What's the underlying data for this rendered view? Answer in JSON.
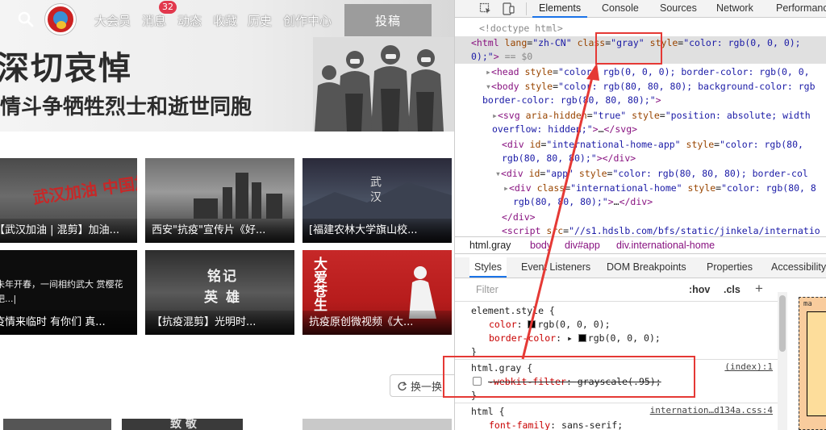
{
  "nav": {
    "items": [
      "大会员",
      "消息",
      "动态",
      "收藏",
      "历史",
      "创作中心"
    ],
    "badge": "32",
    "upload": "投稿"
  },
  "banner": {
    "title": "深切哀悼",
    "subtitle": "情斗争牺牲烈士和逝世同胞"
  },
  "videos": [
    {
      "caption": "【武汉加油 | 混剪】加油...",
      "overlay": "武汉加油 中国加油"
    },
    {
      "caption": "西安\"抗疫\"宣传片《好...",
      "overlay": ""
    },
    {
      "caption": "[福建农林大学旗山校...",
      "overlay": "武 汉"
    },
    {
      "caption": "疫情来临时 有你们 真...",
      "overlay": "未年开春，一间相约武大 赏樱花吧...|"
    },
    {
      "caption": "【抗疫混剪】光明时...",
      "overlay": "铭记 英 雄"
    },
    {
      "caption": "抗疫原创微视频《大...",
      "overlay": "大爱苍生"
    }
  ],
  "swap_label": "换一换",
  "bottom_tile_text": "致 敬",
  "devtools": {
    "tabs": [
      "Elements",
      "Console",
      "Sources",
      "Network",
      "Performance"
    ],
    "active_tab": "Elements",
    "breadcrumbs": [
      "html.gray",
      "body",
      "div#app",
      "div.international-home"
    ],
    "subtabs": [
      "Styles",
      "Event Listeners",
      "DOM Breakpoints",
      "Properties",
      "Accessibility"
    ],
    "filter_placeholder": "Filter",
    "hov": ":hov",
    "cls": ".cls",
    "plus": "+",
    "html_lang_value": "\"zh-CN\"",
    "class_value": "\"gray\"",
    "style_value": "\"color: rgb(0, 0, 0);",
    "dollar": "== $0",
    "doctype": "<!doctype html>",
    "rules": {
      "element_style": {
        "selector": "element.style {",
        "color": "rgb(0, 0, 0);",
        "border_color": "rgb(0, 0, 0);"
      },
      "html_gray": {
        "selector": "html.gray {",
        "source": "(index):1",
        "prop": "-webkit-filter",
        "value": "grayscale(.95);"
      },
      "html": {
        "selector": "html {",
        "source": "internation…d134a.css:4",
        "prop": "font-family",
        "value": "sans-serif;"
      }
    },
    "box_label": "ma"
  },
  "colors": {
    "annotation": "#e53935",
    "devtools_bg": "#f3f3f3",
    "tag": "#881280",
    "attr": "#994500",
    "value": "#1a1aa6"
  }
}
